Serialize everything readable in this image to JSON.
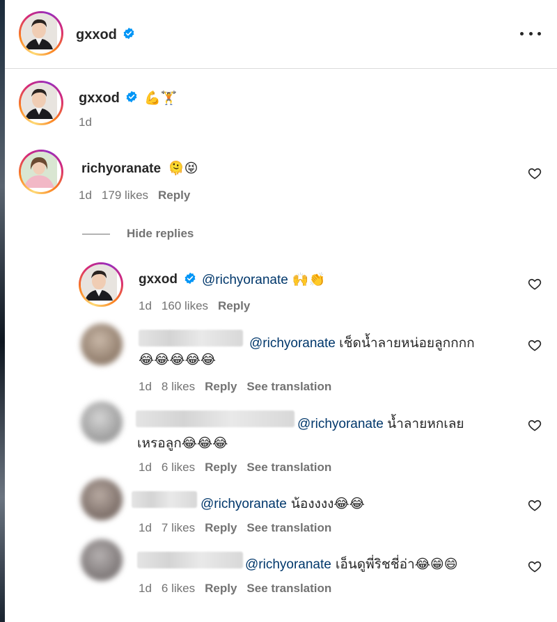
{
  "header": {
    "username": "gxxod",
    "more_icon": "more-horizontal-icon"
  },
  "caption": {
    "username": "gxxod",
    "text": "💪🏋",
    "time": "1d"
  },
  "comment": {
    "username": "richyoranate",
    "text": "🫠😝",
    "time": "1d",
    "likes": "179 likes",
    "reply_label": "Reply"
  },
  "hide_replies_label": "Hide replies",
  "replies": [
    {
      "username": "gxxod",
      "mention": "@richyoranate",
      "text": " 🙌👏",
      "time": "1d",
      "likes": "160 likes",
      "reply_label": "Reply"
    },
    {
      "mention": "@richyoranate",
      "text": " เช็ดน้ำลายหน่อยลูกกกก",
      "text2": "😂😂😂😂😂",
      "time": "1d",
      "likes": "8 likes",
      "reply_label": "Reply",
      "translate_label": "See translation"
    },
    {
      "mention": "@richyoranate",
      "text": " น้ำลายหกเลย",
      "text2": "เหรอลูก😂😂😂",
      "time": "1d",
      "likes": "6 likes",
      "reply_label": "Reply",
      "translate_label": "See translation"
    },
    {
      "mention": "@richyoranate",
      "text": " น้องงงง😂😂",
      "time": "1d",
      "likes": "7 likes",
      "reply_label": "Reply",
      "translate_label": "See translation"
    },
    {
      "mention": "@richyoranate",
      "text": " เอ็นดูพี่ริชชี่อ่า😂😁😄",
      "time": "1d",
      "likes": "6 likes",
      "reply_label": "Reply",
      "translate_label": "See translation"
    }
  ],
  "colors": {
    "verified": "#0095f6",
    "mention": "#00376b",
    "meta": "#737373"
  }
}
